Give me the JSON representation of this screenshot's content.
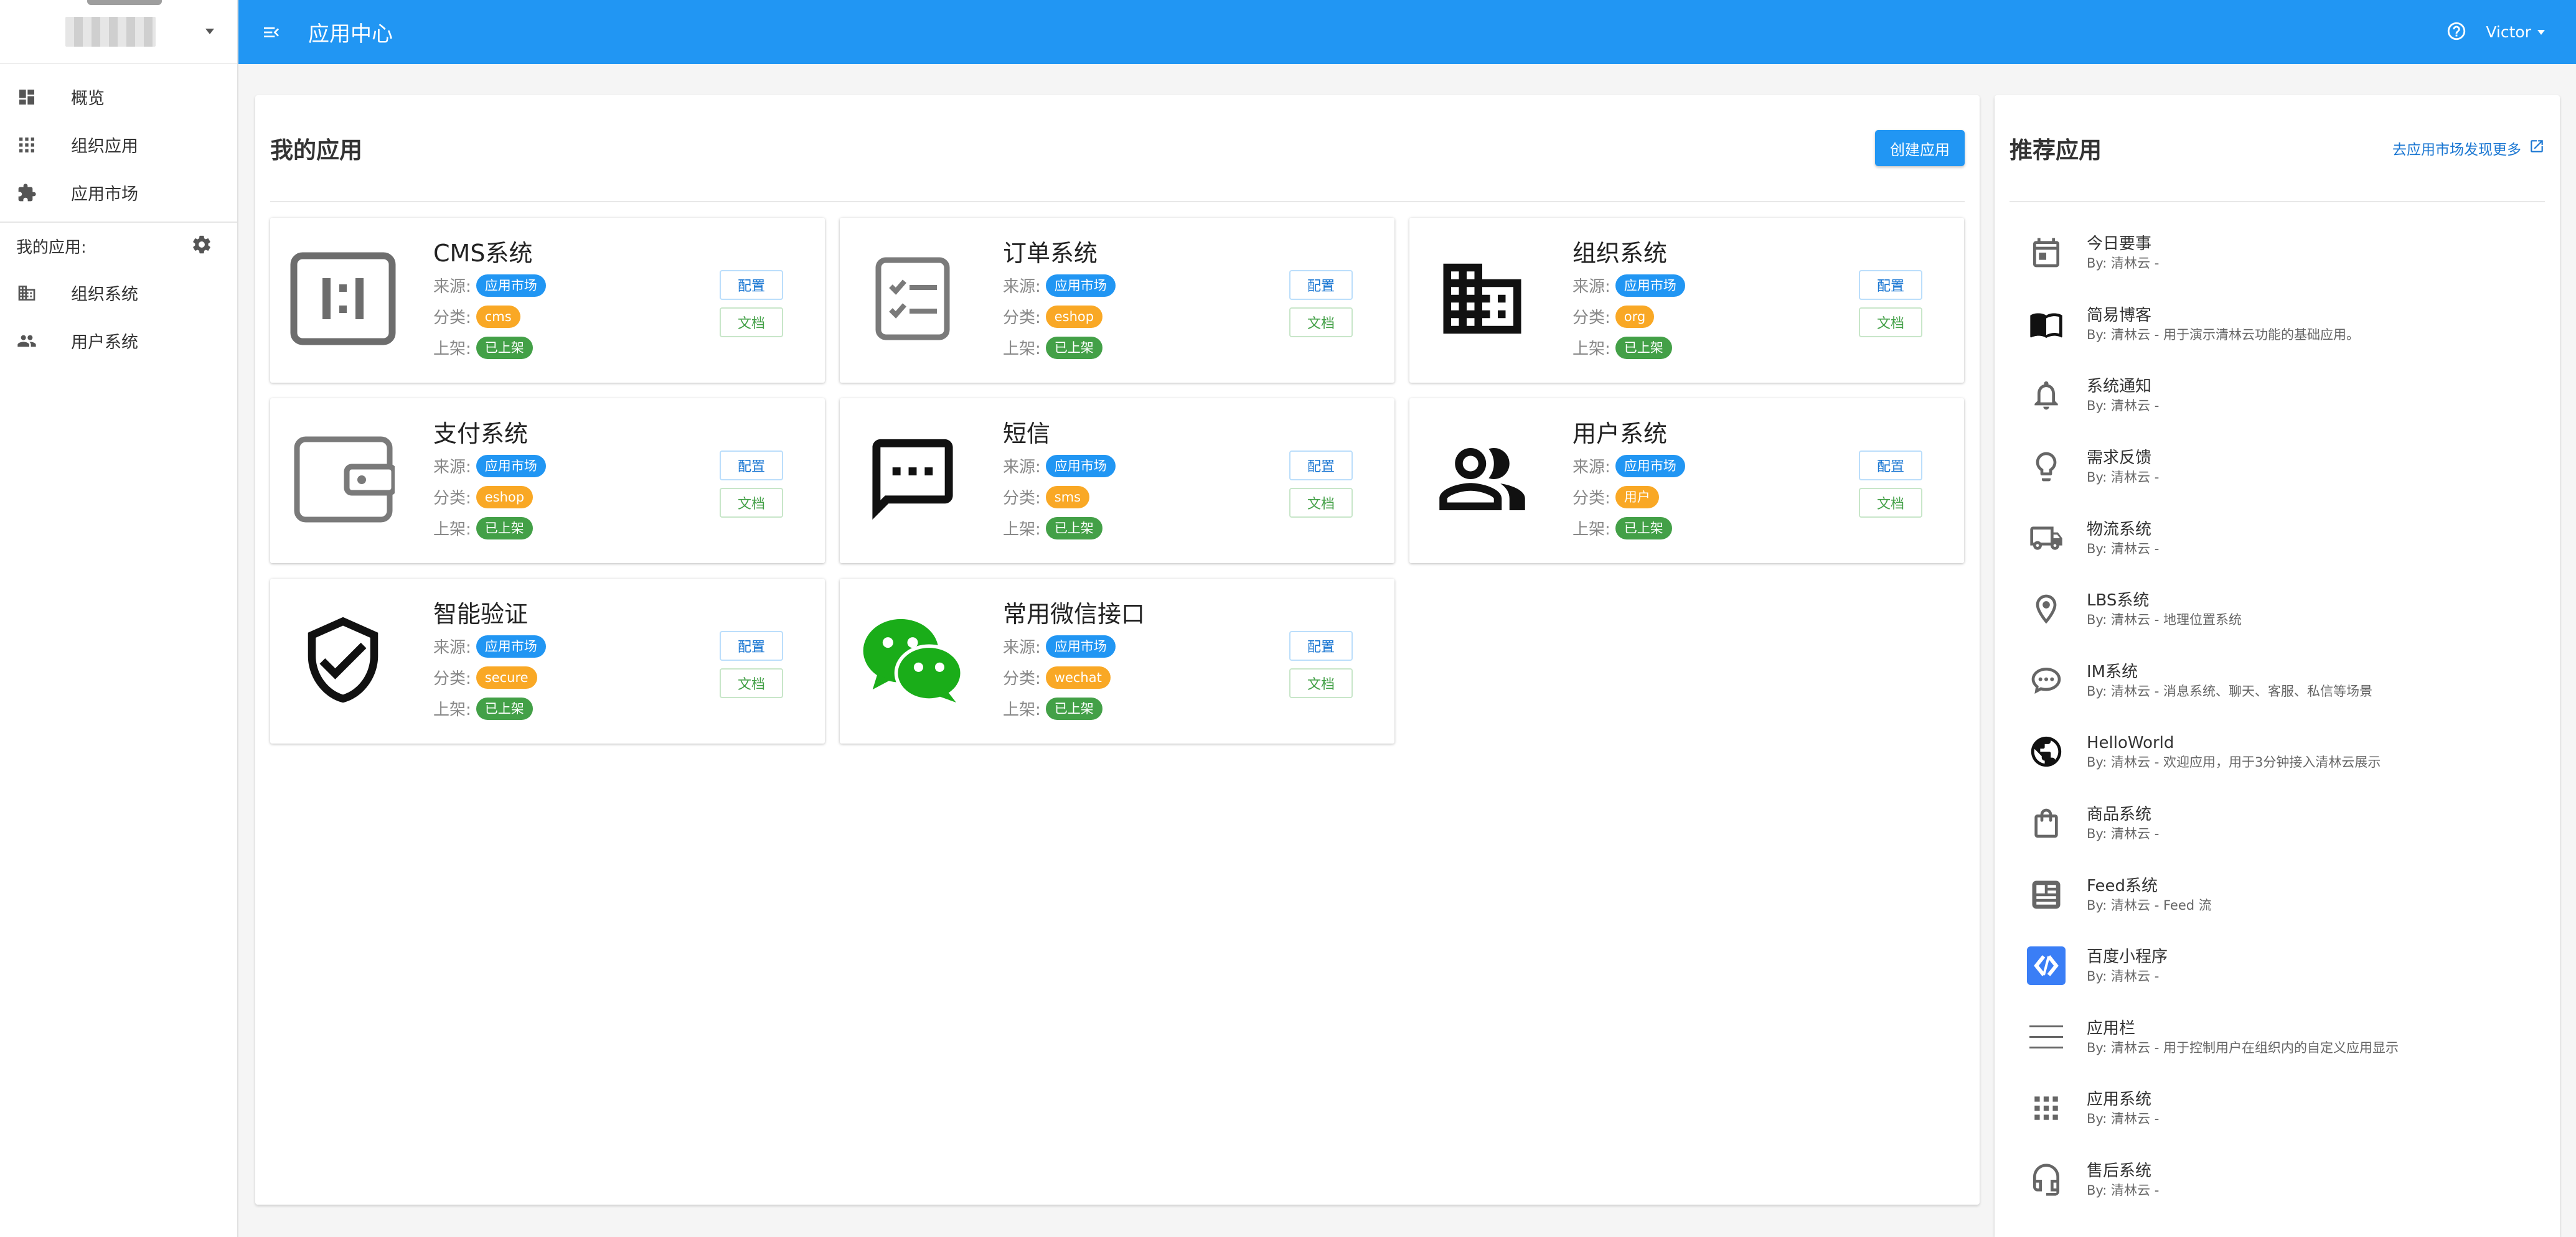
{
  "sidebar": {
    "nav": [
      {
        "label": "概览",
        "icon": "dashboard-icon"
      },
      {
        "label": "组织应用",
        "icon": "apps-grid-icon"
      },
      {
        "label": "应用市场",
        "icon": "puzzle-icon"
      }
    ],
    "my_apps_label": "我的应用:",
    "my_apps": [
      {
        "label": "组织系统",
        "icon": "building-icon"
      },
      {
        "label": "用户系统",
        "icon": "people-icon"
      }
    ]
  },
  "topbar": {
    "title": "应用中心",
    "user": "Victor"
  },
  "main": {
    "title": "我的应用",
    "create_label": "创建应用",
    "field_labels": {
      "source": "来源:",
      "category": "分类:",
      "listed": "上架:"
    },
    "buttons": {
      "config": "配置",
      "docs": "文档"
    },
    "apps": [
      {
        "name": "CMS系统",
        "source": "应用市场",
        "category": "cms",
        "status": "已上架",
        "icon": "cms-icon"
      },
      {
        "name": "订单系统",
        "source": "应用市场",
        "category": "eshop",
        "status": "已上架",
        "icon": "checklist-icon"
      },
      {
        "name": "组织系统",
        "source": "应用市场",
        "category": "org",
        "status": "已上架",
        "icon": "building-icon"
      },
      {
        "name": "支付系统",
        "source": "应用市场",
        "category": "eshop",
        "status": "已上架",
        "icon": "wallet-icon"
      },
      {
        "name": "短信",
        "source": "应用市场",
        "category": "sms",
        "status": "已上架",
        "icon": "sms-icon"
      },
      {
        "name": "用户系统",
        "source": "应用市场",
        "category": "用户",
        "status": "已上架",
        "icon": "people-icon"
      },
      {
        "name": "智能验证",
        "source": "应用市场",
        "category": "secure",
        "status": "已上架",
        "icon": "shield-check-icon"
      },
      {
        "name": "常用微信接口",
        "source": "应用市场",
        "category": "wechat",
        "status": "已上架",
        "icon": "wechat-icon"
      }
    ]
  },
  "recommended": {
    "title": "推荐应用",
    "more_label": "去应用市场发现更多",
    "items": [
      {
        "name": "今日要事",
        "by": "By: 清林云 -",
        "icon": "calendar-icon"
      },
      {
        "name": "简易博客",
        "by": "By: 清林云 - 用于演示清林云功能的基础应用。",
        "icon": "book-icon"
      },
      {
        "name": "系统通知",
        "by": "By: 清林云 -",
        "icon": "bell-icon"
      },
      {
        "name": "需求反馈",
        "by": "By: 清林云 -",
        "icon": "lightbulb-icon"
      },
      {
        "name": "物流系统",
        "by": "By: 清林云 -",
        "icon": "truck-icon"
      },
      {
        "name": "LBS系统",
        "by": "By: 清林云 - 地理位置系统",
        "icon": "location-pin-icon"
      },
      {
        "name": "IM系统",
        "by": "By: 清林云 - 消息系统、聊天、客服、私信等场景",
        "icon": "chat-bubble-icon"
      },
      {
        "name": "HelloWorld",
        "by": "By: 清林云 - 欢迎应用，用于3分钟接入清林云展示",
        "icon": "globe-icon"
      },
      {
        "name": "商品系统",
        "by": "By: 清林云 -",
        "icon": "shopping-bag-icon"
      },
      {
        "name": "Feed系统",
        "by": "By: 清林云 - Feed 流",
        "icon": "feed-icon"
      },
      {
        "name": "百度小程序",
        "by": "By: 清林云 -",
        "icon": "baidu-miniprogram-icon"
      },
      {
        "name": "应用栏",
        "by": "By: 清林云 - 用于控制用户在组织内的自定义应用显示",
        "icon": "menu-lines-icon"
      },
      {
        "name": "应用系统",
        "by": "By: 清林云 -",
        "icon": "apps-grid-icon"
      },
      {
        "name": "售后系统",
        "by": "By: 清林云 -",
        "icon": "headset-icon"
      }
    ]
  },
  "colors": {
    "primary": "#2196f3",
    "badge_orange": "#f9a825",
    "badge_green": "#43a047",
    "wechat": "#1aad19"
  }
}
